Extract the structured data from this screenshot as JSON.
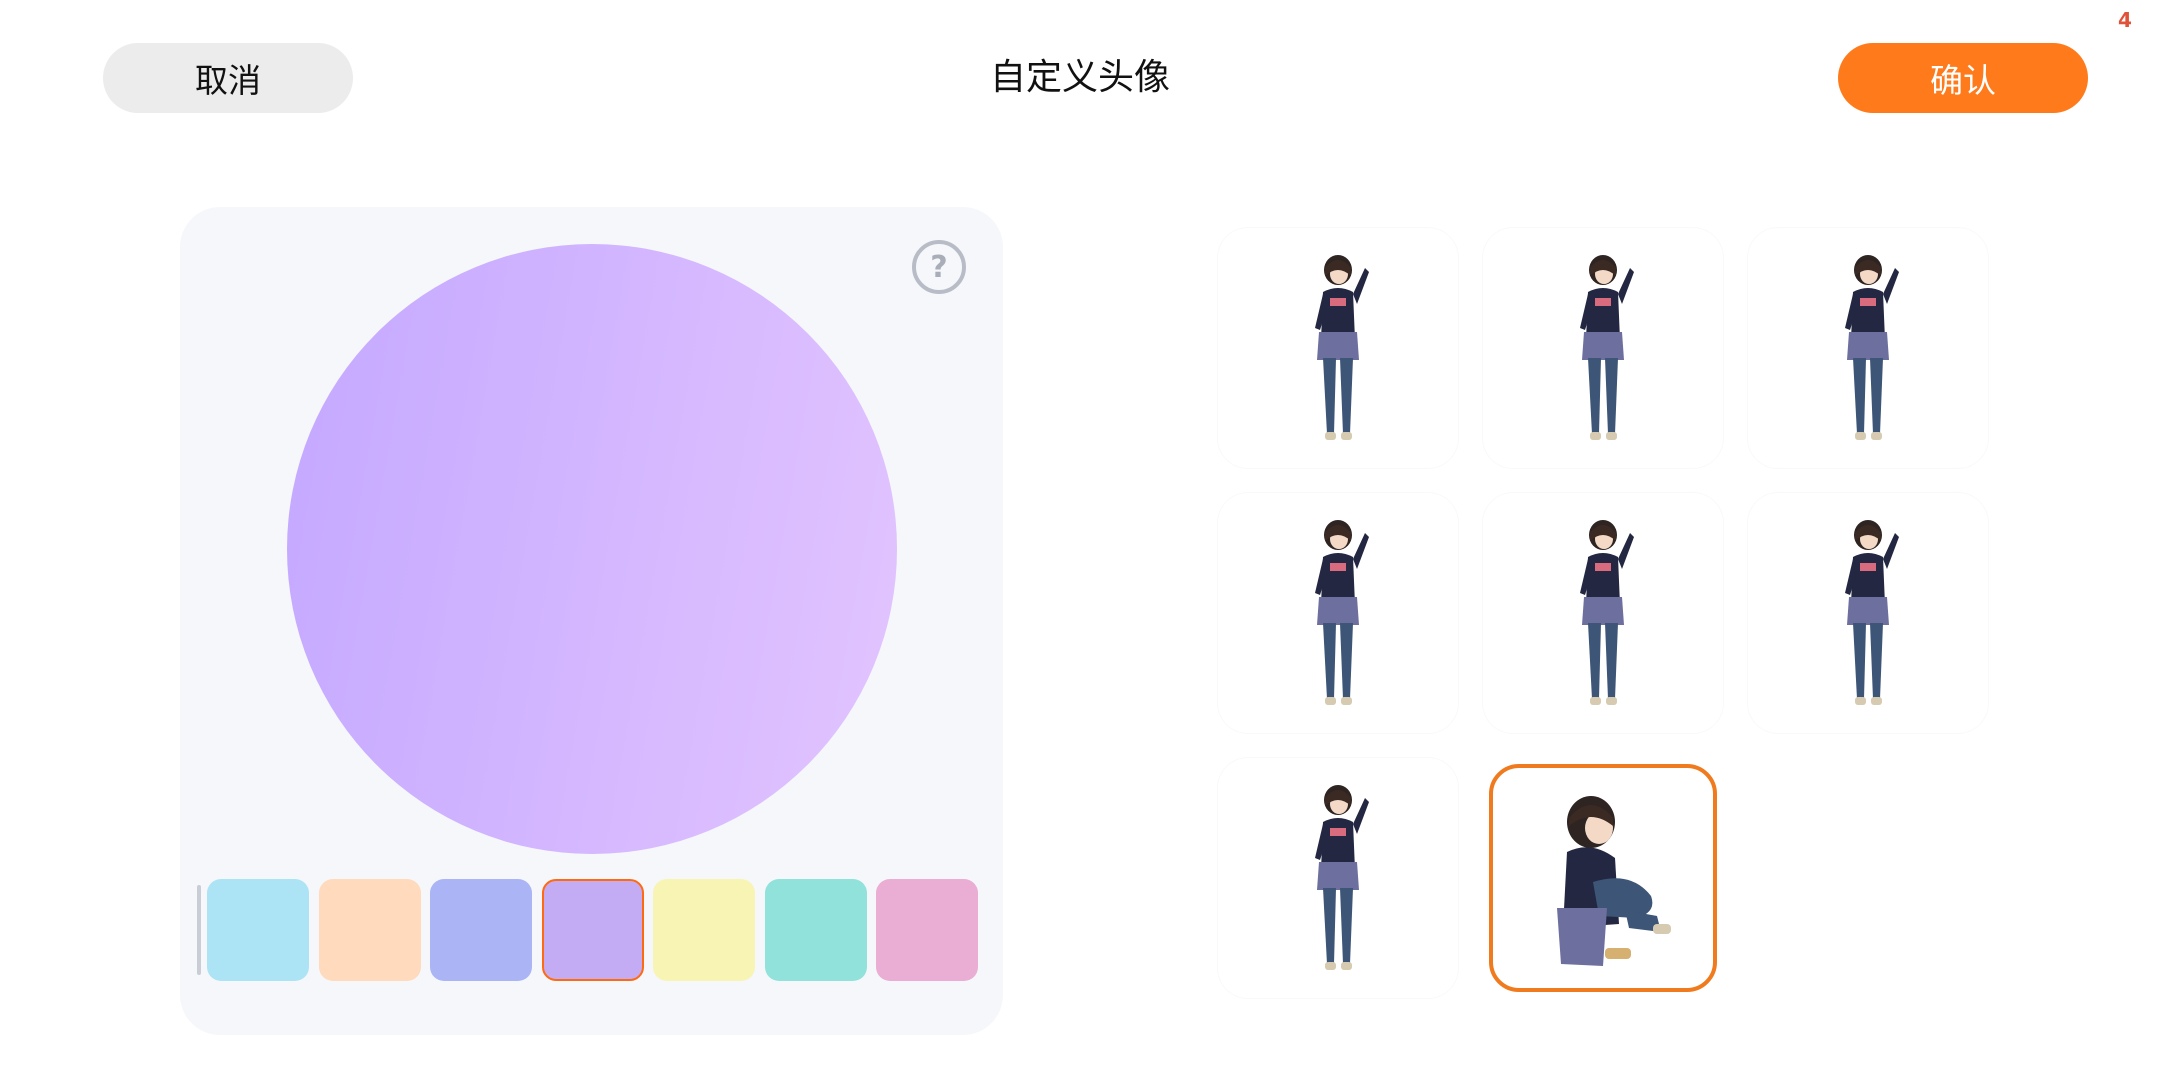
{
  "status": {
    "counter": "4"
  },
  "header": {
    "cancel_label": "取消",
    "title": "自定义头像",
    "confirm_label": "确认"
  },
  "colors": {
    "accent": "#ff7a1a",
    "preview_gradient_start": "#c4a8ff",
    "preview_gradient_end": "#e2c4ff"
  },
  "preview": {
    "help_icon": "question-circle-icon",
    "help_glyph": "?",
    "swatches": [
      {
        "name": "sky-blue",
        "color": "#ade4f5",
        "selected": false
      },
      {
        "name": "peach",
        "color": "#ffdabd",
        "selected": false
      },
      {
        "name": "periwinkle",
        "color": "#abb5f5",
        "selected": false
      },
      {
        "name": "lavender",
        "color": "#c4acf5",
        "selected": true
      },
      {
        "name": "light-yellow",
        "color": "#f8f4b4",
        "selected": false
      },
      {
        "name": "turquoise",
        "color": "#92e2dc",
        "selected": false
      },
      {
        "name": "pink",
        "color": "#eaadd4",
        "selected": false
      }
    ]
  },
  "poses": [
    {
      "id": "pose-1",
      "type": "standing",
      "selected": false
    },
    {
      "id": "pose-2",
      "type": "standing",
      "selected": false
    },
    {
      "id": "pose-3",
      "type": "standing",
      "selected": false
    },
    {
      "id": "pose-4",
      "type": "standing",
      "selected": false
    },
    {
      "id": "pose-5",
      "type": "standing",
      "selected": false
    },
    {
      "id": "pose-6",
      "type": "standing",
      "selected": false
    },
    {
      "id": "pose-7",
      "type": "standing",
      "selected": false
    },
    {
      "id": "pose-8",
      "type": "sitting",
      "selected": true
    }
  ]
}
